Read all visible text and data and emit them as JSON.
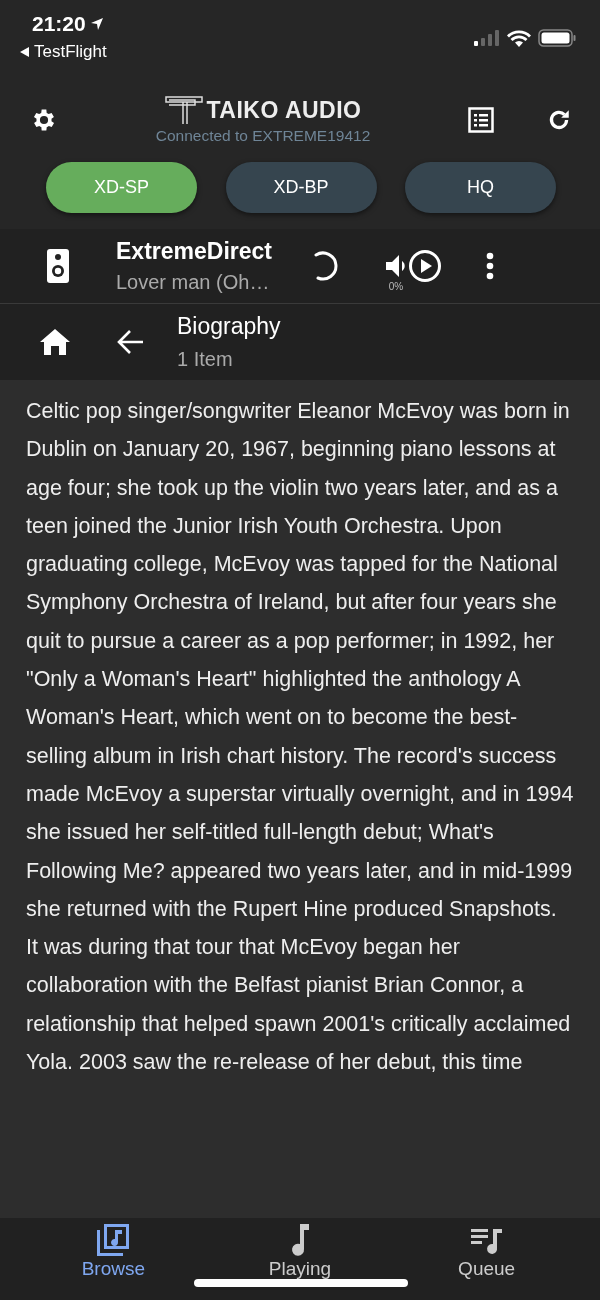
{
  "status_bar": {
    "time": "21:20",
    "back_label": "TestFlight"
  },
  "header": {
    "brand": "TAIKO AUDIO",
    "connection": "Connected to EXTREME19412"
  },
  "modes": [
    {
      "label": "XD-SP",
      "selected": true
    },
    {
      "label": "XD-BP",
      "selected": false
    },
    {
      "label": "HQ",
      "selected": false
    }
  ],
  "now_playing": {
    "device": "ExtremeDirect",
    "track": "Lover man (Oh…",
    "volume": "0%"
  },
  "nav": {
    "title": "Biography",
    "subtitle": "1 Item"
  },
  "biography": "Celtic pop singer/songwriter Eleanor McEvoy was born in Dublin on January 20, 1967, beginning piano lessons at age four; she took up the violin two years later, and as a teen joined the Junior Irish Youth Orchestra. Upon graduating college, McEvoy was tapped for the National Symphony Orchestra of Ireland, but after four years she quit to pursue a career as a pop performer; in 1992, her \"Only a Woman's Heart\" highlighted the anthology A Woman's Heart, which went on to become the best-selling album in Irish chart history. The record's success made McEvoy a superstar virtually overnight, and in 1994 she issued her self-titled full-length debut; What's Following Me? appeared two years later, and in mid-1999 she returned with the Rupert Hine produced Snapshots. It was during that tour that McEvoy began her collaboration with the Belfast pianist Brian Connor, a relationship that helped spawn 2001's critically acclaimed Yola. 2003 saw the re-release of her debut, this time",
  "tabs": [
    {
      "label": "Browse",
      "kind": "browse",
      "selected": true
    },
    {
      "label": "Playing",
      "kind": "playing",
      "selected": false
    },
    {
      "label": "Queue",
      "kind": "queue",
      "selected": false
    }
  ]
}
